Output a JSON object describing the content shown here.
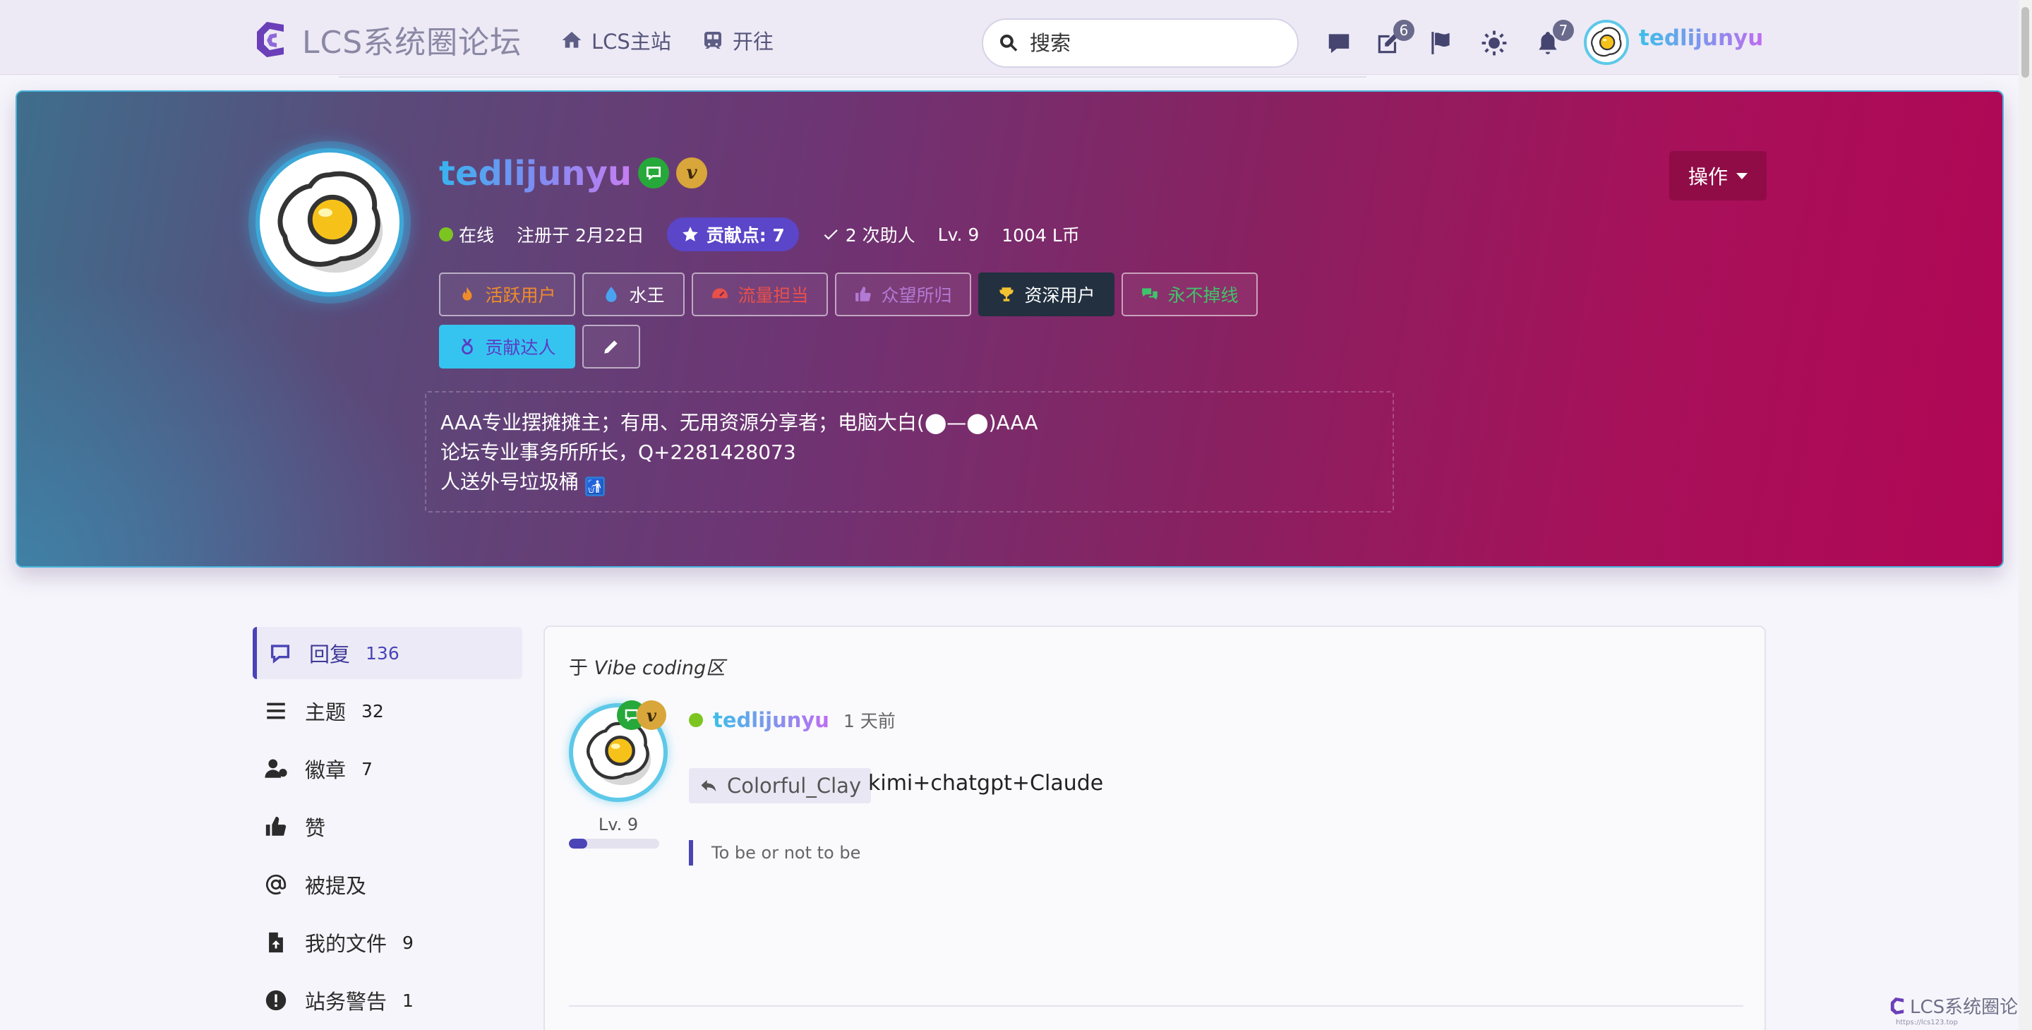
{
  "header": {
    "site_title": "LCS系统圈论坛",
    "nav": [
      {
        "label": "LCS主站",
        "icon": "home-icon"
      },
      {
        "label": "开往",
        "icon": "train-icon"
      }
    ],
    "search": {
      "placeholder": "搜索",
      "icon": "search-icon"
    },
    "icons": [
      {
        "name": "chat-icon",
        "badge": ""
      },
      {
        "name": "edit-icon",
        "badge": "6"
      },
      {
        "name": "flag-icon",
        "badge": ""
      },
      {
        "name": "theme-icon",
        "badge": ""
      },
      {
        "name": "bell-icon",
        "badge": "7"
      }
    ],
    "username": "tedlijunyu"
  },
  "profile": {
    "name": "tedlijunyu",
    "status": "在线",
    "registered": "注册于 2月22日",
    "contribution": "贡献点: 7",
    "helped": "2 次助人",
    "level": "Lv. 9",
    "coins": "1004 L币",
    "action_label": "操作",
    "badges": [
      {
        "label": "活跃用户",
        "icon": "fire-icon",
        "color": "#f08c2a"
      },
      {
        "label": "水王",
        "icon": "water-drop-icon",
        "color": "#ffffff"
      },
      {
        "label": "流量担当",
        "icon": "gauge-icon",
        "color": "#e8504a"
      },
      {
        "label": "众望所归",
        "icon": "thumbs-up-icon",
        "color": "#b37ad4"
      },
      {
        "label": "资深用户",
        "icon": "trophy-icon",
        "color": "#ffffff"
      },
      {
        "label": "永不掉线",
        "icon": "comments-icon",
        "color": "#3ec46a"
      },
      {
        "label": "贡献达人",
        "icon": "medal-icon",
        "color": "#5b3cc4"
      }
    ],
    "bio_lines": [
      "AAA专业摆摊摊主；有用、无用资源分享者；电脑大白(⬤—⬤)AAA",
      "论坛专业事务所所长，Q+2281428073",
      "人送外号垃圾桶"
    ],
    "bio_trash_icon": "🚮"
  },
  "sidebar": {
    "items": [
      {
        "label": "回复",
        "count": "136",
        "icon": "reply-icon"
      },
      {
        "label": "主题",
        "count": "32",
        "icon": "list-icon"
      },
      {
        "label": "徽章",
        "count": "7",
        "icon": "user-badge-icon"
      },
      {
        "label": "赞",
        "count": "",
        "icon": "thumbs-up-icon"
      },
      {
        "label": "被提及",
        "count": "",
        "icon": "at-icon"
      },
      {
        "label": "我的文件",
        "count": "9",
        "icon": "file-upload-icon"
      },
      {
        "label": "站务警告",
        "count": "1",
        "icon": "warning-icon"
      }
    ]
  },
  "post": {
    "context_prefix": "于 ",
    "category": "Vibe coding区",
    "author": "tedlijunyu",
    "time": "1 天前",
    "level": "Lv. 9",
    "level_progress": 0.2,
    "reply_to": "Colorful_Clay",
    "body": "kimi+chatgpt+Claude",
    "signature": "To be or not to be"
  },
  "footer": {
    "watermark": "LCS系统圈论坛",
    "url": "https://lcs123.top"
  }
}
